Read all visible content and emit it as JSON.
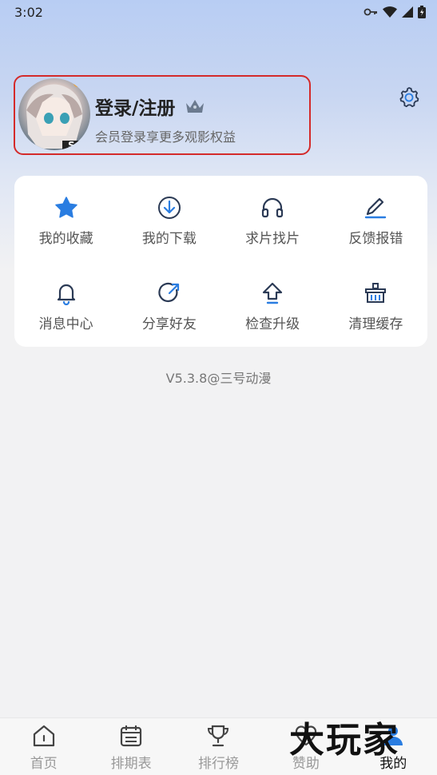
{
  "status_bar": {
    "time": "3:02"
  },
  "profile": {
    "title": "登录/注册",
    "subtitle": "会员登录享更多观影权益"
  },
  "grid": [
    {
      "label": "我的收藏",
      "icon": "star-icon"
    },
    {
      "label": "我的下载",
      "icon": "download-icon"
    },
    {
      "label": "求片找片",
      "icon": "headphones-icon"
    },
    {
      "label": "反馈报错",
      "icon": "edit-icon"
    },
    {
      "label": "消息中心",
      "icon": "bell-icon"
    },
    {
      "label": "分享好友",
      "icon": "share-icon"
    },
    {
      "label": "检查升级",
      "icon": "upgrade-icon"
    },
    {
      "label": "清理缓存",
      "icon": "trash-icon"
    }
  ],
  "version": "V5.3.8@三号动漫",
  "bottom_nav": [
    {
      "label": "首页",
      "icon": "home-icon"
    },
    {
      "label": "排期表",
      "icon": "calendar-icon"
    },
    {
      "label": "排行榜",
      "icon": "trophy-icon"
    },
    {
      "label": "赞助",
      "icon": "heart-icon"
    },
    {
      "label": "我的",
      "icon": "user-icon",
      "active": true
    }
  ],
  "watermark": "大玩家",
  "colors": {
    "accent": "#2a7de1",
    "highlight_border": "#d42a2a"
  }
}
